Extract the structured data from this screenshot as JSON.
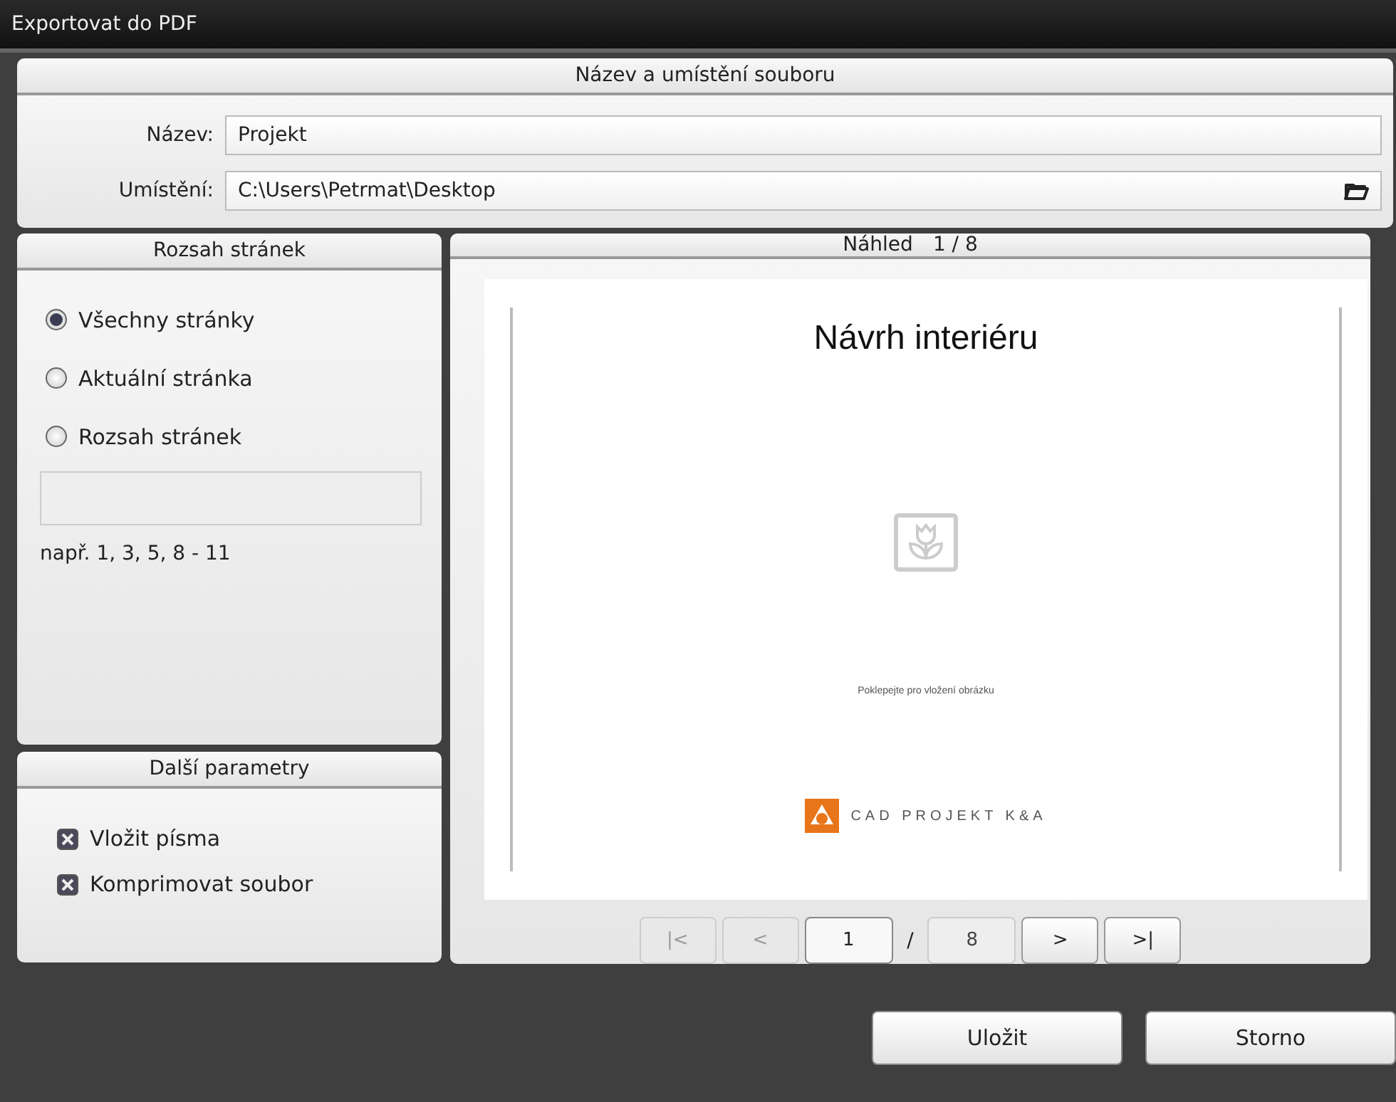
{
  "window": {
    "title": "Exportovat do PDF"
  },
  "file_section": {
    "title": "Název a umístění souboru",
    "name_label": "Název:",
    "name_value": "Projekt",
    "location_label": "Umístění:",
    "location_value": "C:\\Users\\Petrmat\\Desktop"
  },
  "page_range": {
    "title": "Rozsah stránek",
    "options": [
      {
        "label": "Všechny stránky",
        "selected": true
      },
      {
        "label": "Aktuální stránka",
        "selected": false
      },
      {
        "label": "Rozsah stránek",
        "selected": false
      }
    ],
    "hint": "např. 1, 3, 5, 8 - 11"
  },
  "more_options": {
    "title": "Další parametry",
    "checkboxes": [
      {
        "label": "Vložit písma",
        "checked": true
      },
      {
        "label": "Komprimovat soubor",
        "checked": true
      }
    ]
  },
  "preview": {
    "title": "Náhled",
    "counter": "1 / 8",
    "page": {
      "heading": "Návrh interiéru",
      "image_hint": "Poklepejte pro vložení obrázku",
      "logo_text": "CAD PROJEKT K&A"
    },
    "pager": [
      {
        "kind": "button",
        "label": "|<",
        "disabled": true
      },
      {
        "kind": "button",
        "label": "<",
        "disabled": true
      },
      {
        "kind": "field",
        "label": "1"
      },
      {
        "kind": "separator",
        "label": "/"
      },
      {
        "kind": "total",
        "label": "8"
      },
      {
        "kind": "button",
        "label": ">",
        "disabled": false
      },
      {
        "kind": "button",
        "label": ">|",
        "disabled": false
      }
    ]
  },
  "buttons": [
    "Uložit",
    "Storno"
  ]
}
